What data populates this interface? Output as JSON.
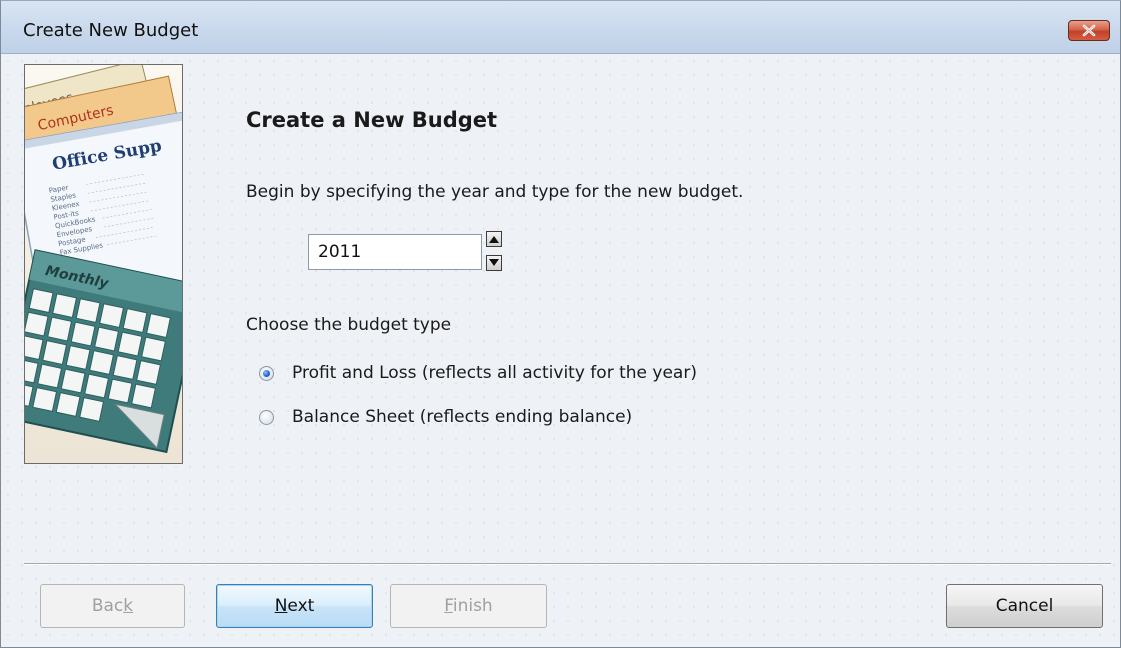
{
  "window": {
    "title": "Create New Budget"
  },
  "art": {
    "tab_employees": "mployees",
    "tab_computers": "Computers",
    "card_title": "Office Supp",
    "list_items": [
      "Paper",
      "Staples",
      "Kleenex",
      "Post-its",
      "QuickBooks",
      "Envelopes",
      "Postage",
      "Fax Supplies"
    ],
    "calendar_title": "Monthly"
  },
  "content": {
    "heading": "Create a New Budget",
    "intro": "Begin by specifying the year and type for the new budget.",
    "year_value": "2011",
    "type_label": "Choose the budget type",
    "options": [
      {
        "label": "Profit and Loss (reflects all activity for the year)",
        "selected": true
      },
      {
        "label": "Balance Sheet (reflects ending balance)",
        "selected": false
      }
    ]
  },
  "buttons": {
    "back": {
      "pre": "Bac",
      "key": "k",
      "post": "",
      "enabled": false
    },
    "next": {
      "pre": "",
      "key": "N",
      "post": "ext",
      "enabled": true
    },
    "finish": {
      "pre": "",
      "key": "F",
      "post": "inish",
      "enabled": false
    },
    "cancel": {
      "label": "Cancel",
      "enabled": true
    }
  },
  "colors": {
    "titlebar": "#c9d9ec",
    "close_button": "#c2412a",
    "default_button_border": "#3c7fb1",
    "radio_selected": "#1c5fc9"
  },
  "icons": {
    "close": "close-icon",
    "spin_up": "arrow-up-icon",
    "spin_down": "arrow-down-icon"
  }
}
